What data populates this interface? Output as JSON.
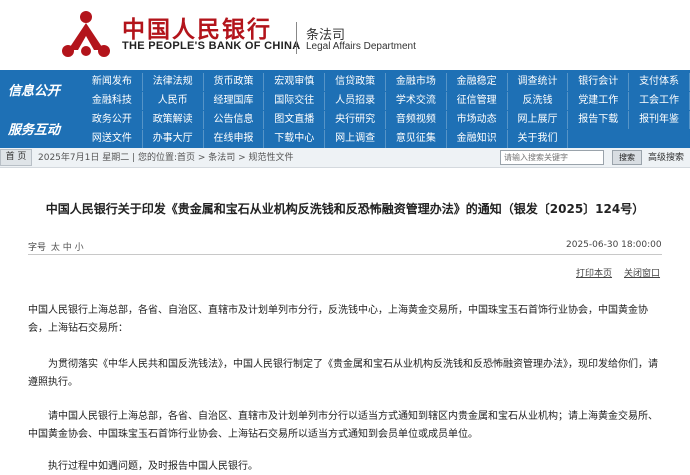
{
  "header": {
    "bank_name_cn": "中国人民银行",
    "bank_name_en": "THE PEOPLE'S BANK OF CHINA",
    "dept_cn": "条法司",
    "dept_en": "Legal Affairs Department"
  },
  "nav": {
    "label_info": "信息公开",
    "label_service": "服务互动",
    "rows": [
      [
        "新闻发布",
        "法律法规",
        "货币政策",
        "宏观审慎",
        "信贷政策",
        "金融市场",
        "金融稳定",
        "调查统计",
        "银行会计",
        "支付体系"
      ],
      [
        "金融科技",
        "人民币",
        "经理国库",
        "国际交往",
        "人员招录",
        "学术交流",
        "征信管理",
        "反洗钱",
        "党建工作",
        "工会工作"
      ],
      [
        "政务公开",
        "政策解读",
        "公告信息",
        "图文直播",
        "央行研究",
        "音频视频",
        "市场动态",
        "网上展厅",
        "报告下载",
        "报刊年鉴"
      ],
      [
        "网送文件",
        "办事大厅",
        "在线申报",
        "下载中心",
        "网上调查",
        "意见征集",
        "金融知识",
        "关于我们"
      ]
    ]
  },
  "breadcrumb": {
    "home_label": "首 页",
    "path": "2025年7月1日 星期二 | 您的位置:首页 > 条法司 > 规范性文件",
    "search_placeholder": "请输入搜索关键字",
    "search_button": "搜索",
    "advanced_search": "高级搜索"
  },
  "article": {
    "title": "中国人民银行关于印发《贵金属和宝石从业机构反洗钱和反恐怖融资管理办法》的通知（银发〔2025〕124号）",
    "font_size_label": "字号",
    "font_size_options": "太 中 小",
    "date": "2025-06-30 18:00:00",
    "print_label": "打印本页",
    "close_label": "关闭窗口",
    "paragraphs": [
      "中国人民银行上海总部，各省、自治区、直辖市及计划单列市分行，反洗钱中心，上海黄金交易所，中国珠宝玉石首饰行业协会，中国黄金协会，上海钻石交易所：",
      "为贯彻落实《中华人民共和国反洗钱法》，中国人民银行制定了《贵金属和宝石从业机构反洗钱和反恐怖融资管理办法》，现印发给你们，请遵照执行。",
      "请中国人民银行上海总部，各省、自治区、直辖市及计划单列市分行以适当方式通知到辖区内贵金属和宝石从业机构；请上海黄金交易所、中国黄金协会、中国珠宝玉石首饰行业协会、上海钻石交易所以适当方式通知到会员单位或成员单位。",
      "执行过程中如遇问题，及时报告中国人民银行。"
    ]
  },
  "colors": {
    "brand_red": "#b3141b",
    "nav_blue": "#1e70b5"
  }
}
